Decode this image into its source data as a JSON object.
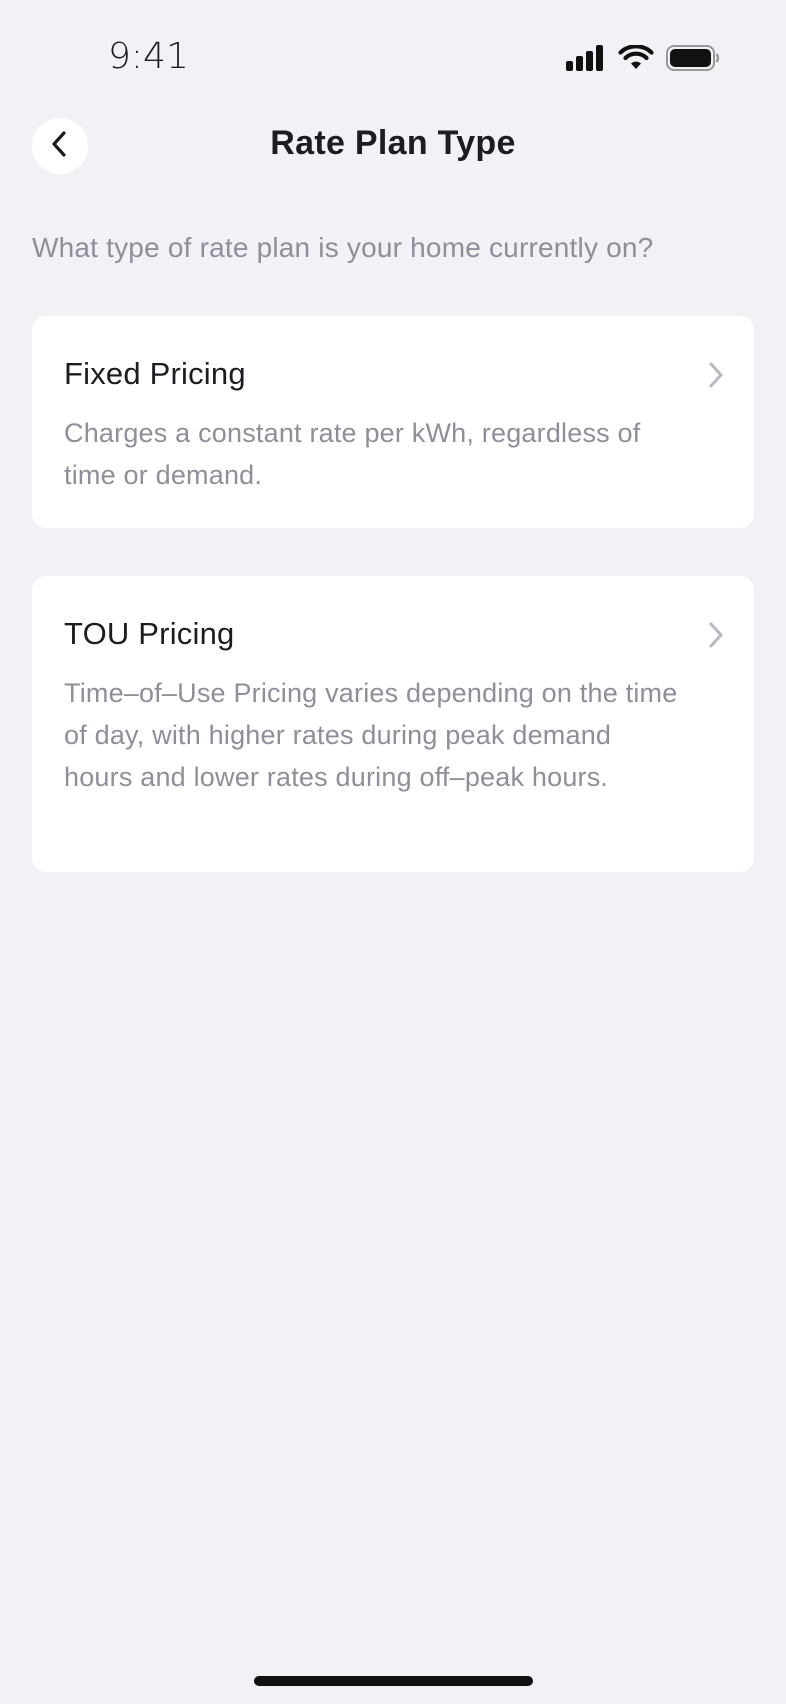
{
  "status_bar": {
    "time": "9:41",
    "icons": [
      "signal-icon",
      "wifi-icon",
      "battery-icon"
    ]
  },
  "header": {
    "title": "Rate Plan Type",
    "back_icon": "chevron-left-icon"
  },
  "question": "What type of rate plan is your home currently on?",
  "options": [
    {
      "title": "Fixed Pricing",
      "description": "Charges a constant rate per kWh, regardless of time or demand."
    },
    {
      "title": "TOU Pricing",
      "description": "Time–of–Use Pricing varies depending on the time of day, with higher rates during peak demand hours and lower rates during off–peak hours."
    }
  ],
  "colors": {
    "background": "#F1F1F6",
    "card": "#FFFFFF",
    "text_primary": "#1C1D22",
    "text_secondary": "#8E8F99",
    "chevron": "#B8B9C0"
  }
}
